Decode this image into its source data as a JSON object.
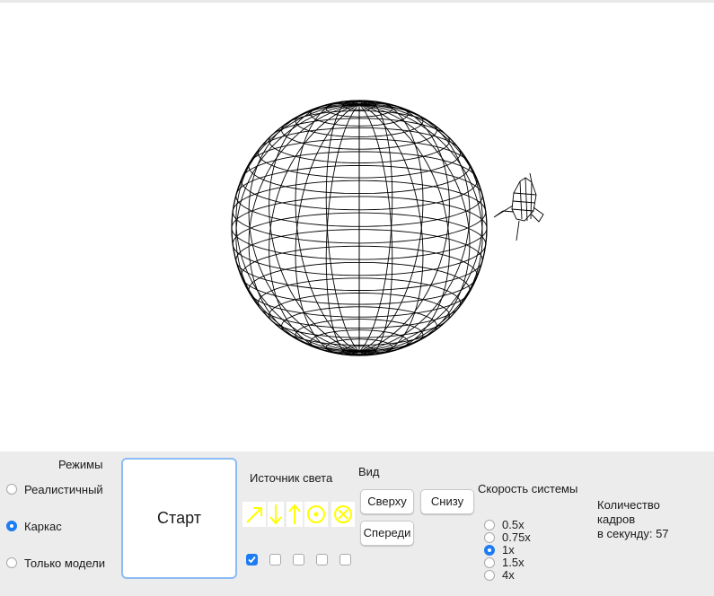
{
  "modes": {
    "title": "Режимы",
    "options": [
      {
        "label": "Реалистичный",
        "selected": false
      },
      {
        "label": "Каркас",
        "selected": true
      },
      {
        "label": "Только модели",
        "selected": false
      }
    ]
  },
  "start_button_label": "Старт",
  "light_source": {
    "title": "Источник света",
    "directions": [
      "diagonal-arrow-icon",
      "down-arrow-icon",
      "up-arrow-icon",
      "toward-viewer-icon",
      "away-from-viewer-icon"
    ],
    "checkboxes": [
      true,
      false,
      false,
      false,
      false
    ],
    "icon_color": "#ffff00"
  },
  "view": {
    "title": "Вид",
    "top_label": "Сверху",
    "bottom_label": "Снизу",
    "front_label": "Спереди"
  },
  "speed": {
    "title": "Скорость системы",
    "options": [
      {
        "label": "0.5x",
        "selected": false
      },
      {
        "label": "0.75x",
        "selected": false
      },
      {
        "label": "1x",
        "selected": true
      },
      {
        "label": "1.5x",
        "selected": false
      },
      {
        "label": "4x",
        "selected": false
      }
    ]
  },
  "fps": {
    "line1": "Количество",
    "line2": "кадров",
    "line3": "в секунду: 57"
  },
  "colors": {
    "accent": "#1e7cf2",
    "panel": "#ececec",
    "wireframe": "#000000"
  }
}
